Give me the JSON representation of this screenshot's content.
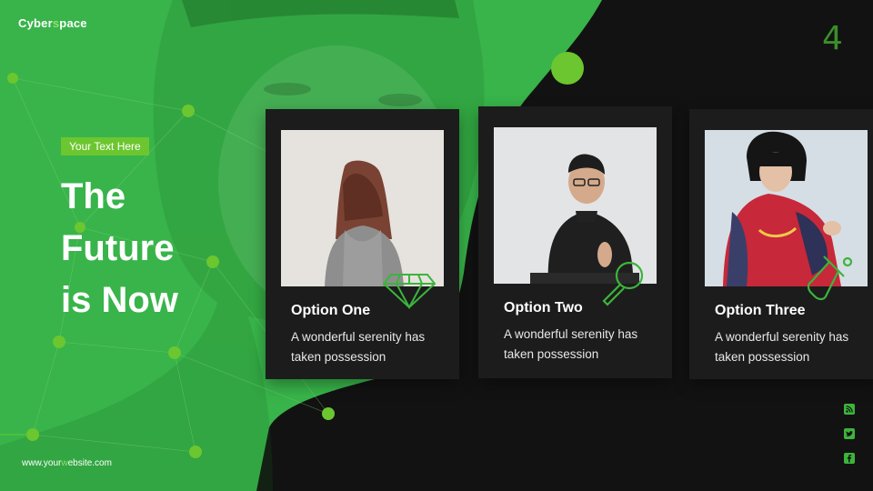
{
  "header": {
    "brand_prefix": "Cyber",
    "brand_dot": "s",
    "brand_suffix": "pace",
    "page_number": "4"
  },
  "hero": {
    "tag": "Your Text Here",
    "title_lines": [
      "The",
      "Future",
      "is Now"
    ]
  },
  "footer": {
    "website_prefix": "www.your",
    "website_dot": "w",
    "website_suffix": "ebsite.com"
  },
  "cards": [
    {
      "title": "Option One",
      "text": "A wonderful serenity has taken possession",
      "icon": "diamond-icon"
    },
    {
      "title": "Option Two",
      "text": "A wonderful serenity has taken possession",
      "icon": "magnifier-icon"
    },
    {
      "title": "Option Three",
      "text": "A wonderful serenity has taken possession",
      "icon": "flask-icon"
    }
  ],
  "social": [
    "rss-icon",
    "twitter-icon",
    "facebook-icon"
  ],
  "colors": {
    "green": "#38b44a",
    "accent": "#6cc62f",
    "dark": "#121212",
    "card": "#1c1c1c"
  }
}
